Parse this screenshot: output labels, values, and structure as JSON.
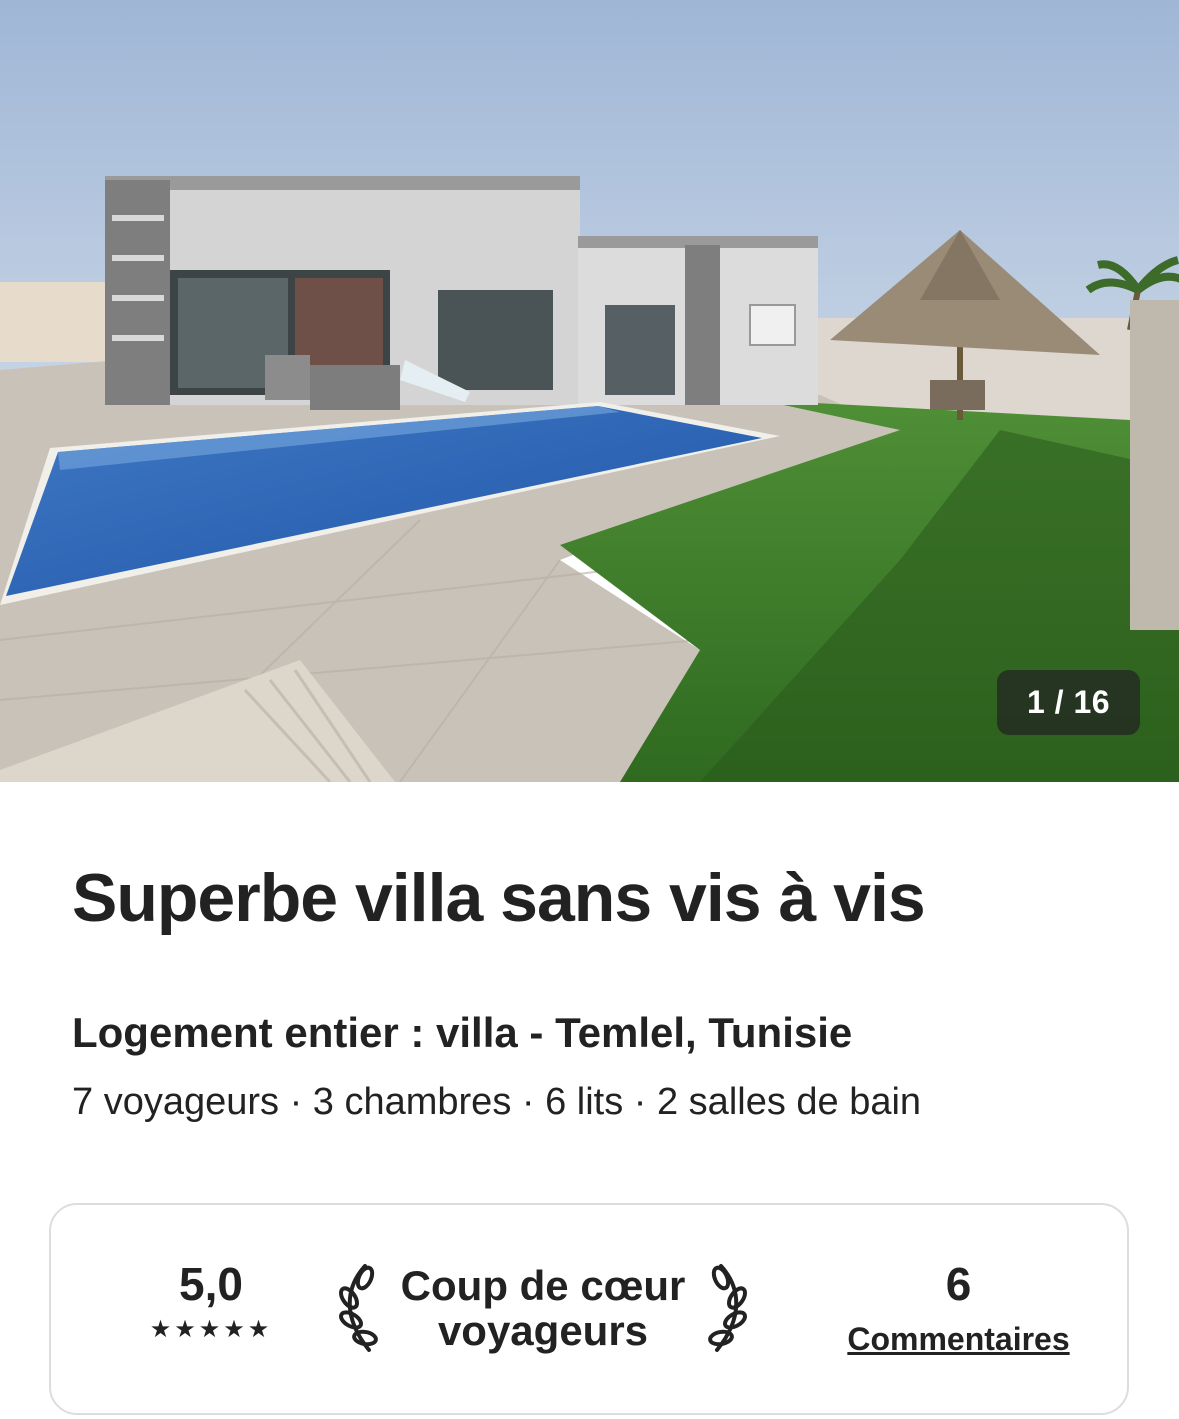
{
  "gallery": {
    "counter": "1 / 16",
    "image_alt": "Villa avec piscine, pelouse et paillote"
  },
  "listing": {
    "title": "Superbe villa sans vis à vis",
    "subtitle": "Logement entier : villa - Temlel, Tunisie",
    "details": "7 voyageurs · 3 chambres · 6 lits · 2 salles de bain"
  },
  "highlights": {
    "rating": "5,0",
    "stars": "★★★★★",
    "star_count": 5,
    "badge_line1": "Coup de cœur",
    "badge_line2": "voyageurs",
    "reviews_count": "6",
    "reviews_label": "Commentaires"
  },
  "colors": {
    "text": "#222222",
    "border": "#dddddd",
    "counter_bg": "#222222"
  }
}
